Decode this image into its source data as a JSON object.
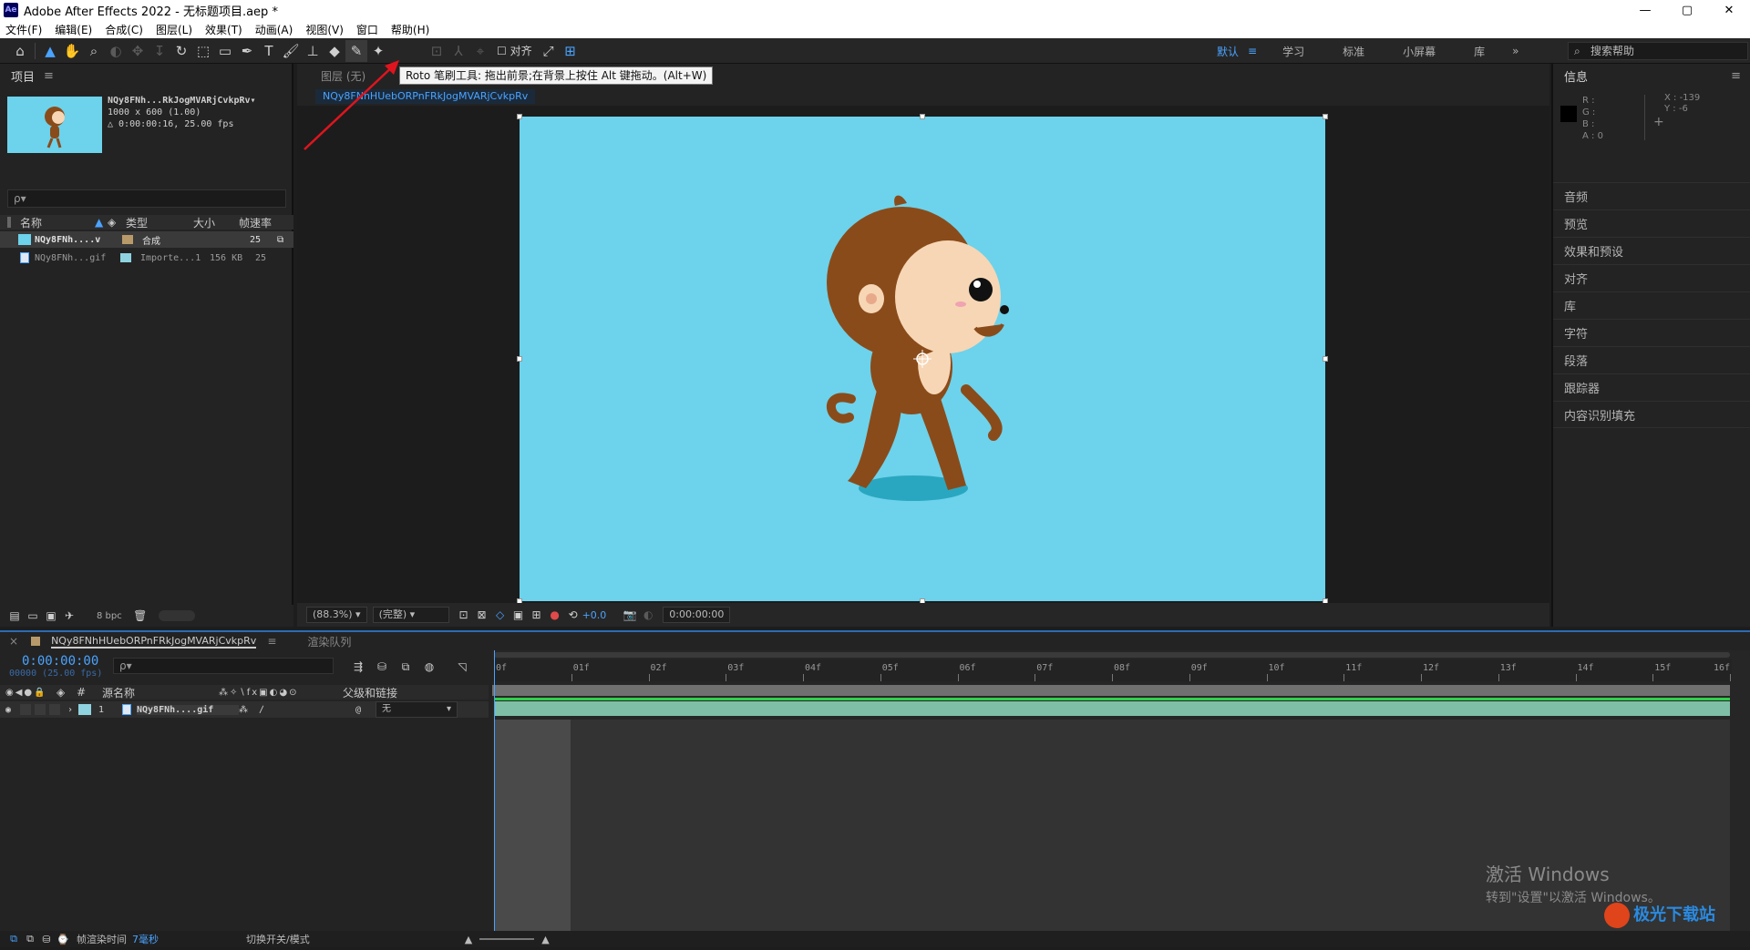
{
  "window": {
    "title": "Adobe After Effects 2022 - 无标题项目.aep *",
    "app_badge": "Ae",
    "controls": [
      "—",
      "▢",
      "✕"
    ]
  },
  "menu": [
    "文件(F)",
    "编辑(E)",
    "合成(C)",
    "图层(L)",
    "效果(T)",
    "动画(A)",
    "视图(V)",
    "窗口",
    "帮助(H)"
  ],
  "toolbar": {
    "align_label": "对齐",
    "tooltip": "Roto 笔刷工具: 拖出前景;在背景上按住 Alt 键拖动。(Alt+W)",
    "workspaces": [
      "默认",
      "学习",
      "标准",
      "小屏幕",
      "库"
    ],
    "current_workspace": "默认",
    "help_placeholder": "搜索帮助"
  },
  "project": {
    "title": "项目",
    "item_name": "NQy8FNh...RkJogMVARjCvkpRv▾",
    "item_dims": "1000 x 600 (1.00)",
    "item_duration": "△ 0:00:00:16, 25.00 fps",
    "search_placeholder": "ρ▾",
    "columns": [
      "名称",
      "类型",
      "大小",
      "帧速率"
    ],
    "rows": [
      {
        "name": "NQy8FNh....v",
        "type": "合成",
        "size": "",
        "fps": "25"
      },
      {
        "name": "NQy8FNh...gif",
        "type": "Importe...1",
        "size": "156 KB",
        "fps": "25"
      }
    ],
    "bpc": "8 bpc"
  },
  "comp": {
    "header": "图层 (无)",
    "tab": "NQy8FNhHUebORPnFRkJogMVARjCvkpRv",
    "zoom": "(88.3%)",
    "quality": "(完整)",
    "exposure": "+0.0",
    "timecode": "0:00:00:00",
    "bg_color": "#6dd2eb"
  },
  "info": {
    "title": "信息",
    "r": "R :",
    "g": "G :",
    "b": "B :",
    "a": "A : 0",
    "x": "X : -139",
    "y": "Y : -6",
    "panels": [
      "音频",
      "预览",
      "效果和预设",
      "对齐",
      "库",
      "字符",
      "段落",
      "跟踪器",
      "内容识别填充"
    ]
  },
  "timeline": {
    "comp_tab": "NQy8FNhHUebORPnFRkJogMVARjCvkpRv",
    "render_tab": "渲染队列",
    "timecode": "0:00:00:00",
    "fps": "00000 (25.00 fps)",
    "search_placeholder": "ρ▾",
    "columns": {
      "num": "#",
      "source": "源名称",
      "parent": "父级和链接"
    },
    "layer": {
      "num": "1",
      "name": "NQy8FNh....gif",
      "parent": "无"
    },
    "ruler": [
      "0f",
      "01f",
      "02f",
      "03f",
      "04f",
      "05f",
      "06f",
      "07f",
      "08f",
      "09f",
      "10f",
      "11f",
      "12f",
      "13f",
      "14f",
      "15f",
      "16f"
    ]
  },
  "status": {
    "render_time_label": "帧渲染时间",
    "render_time": "7毫秒",
    "toggle_label": "切换开关/模式"
  },
  "watermark": {
    "line1": "激活 Windows",
    "line2": "转到\"设置\"以激活 Windows。"
  },
  "brand_logo": "极光下载站"
}
